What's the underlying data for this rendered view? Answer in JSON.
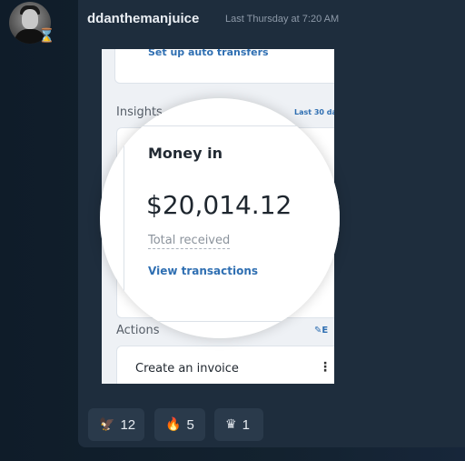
{
  "message": {
    "username": "ddanthemanjuice",
    "timestamp": "Last Thursday at 7:20 AM"
  },
  "screenshot": {
    "top_link": "Set up auto transfers",
    "insights_label": "Insights",
    "range_label": "Last 30 da",
    "money_in": {
      "title": "Money in",
      "amount": "$20,014.12",
      "subtitle": "Total received",
      "link": "View transactions"
    },
    "actions_label": "Actions",
    "edit_label": "E",
    "create_invoice": "Create an invoice",
    "menu_glyph": "⋮"
  },
  "reactions": [
    {
      "icon": "eagle-icon",
      "glyph": "🦅",
      "count": "12"
    },
    {
      "icon": "fire-icon",
      "glyph": "🔥",
      "count": "5"
    },
    {
      "icon": "crown-icon",
      "glyph": "♛",
      "count": "1"
    }
  ],
  "colors": {
    "background": "#13222f",
    "panel": "#1e2d3d",
    "reaction_bg": "#2a3a4b",
    "link_blue": "#2f6fb2"
  }
}
